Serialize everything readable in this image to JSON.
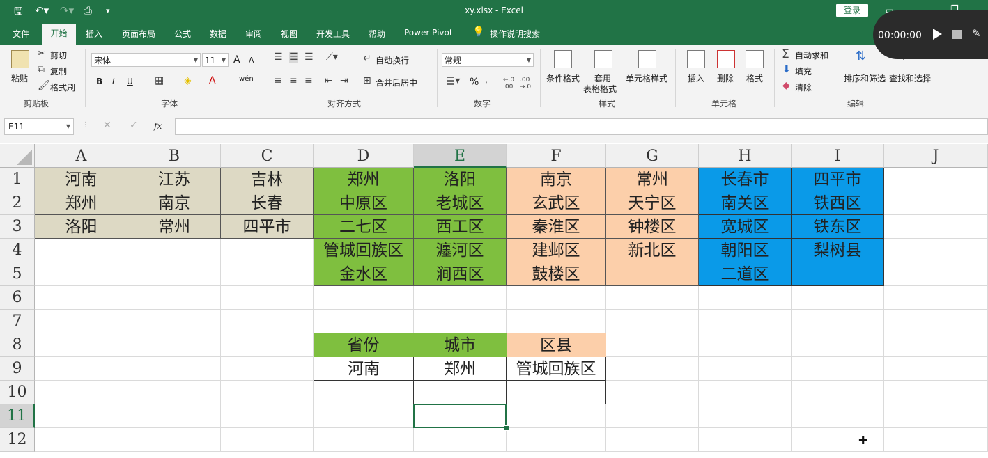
{
  "title": "xy.xlsx  -  Excel",
  "login_label": "登录",
  "tabs": [
    "文件",
    "开始",
    "插入",
    "页面布局",
    "公式",
    "数据",
    "审阅",
    "视图",
    "开发工具",
    "帮助",
    "Power Pivot"
  ],
  "active_tab": "开始",
  "tell_me": "操作说明搜索",
  "clipboard": {
    "paste": "粘贴",
    "cut": "剪切",
    "copy": "复制",
    "format_painter": "格式刷",
    "label": "剪贴板"
  },
  "font": {
    "name": "宋体",
    "size": "11",
    "label": "字体",
    "bold": "B",
    "italic": "I",
    "underline": "U",
    "grow": "A",
    "shrink": "A",
    "wen": "wén"
  },
  "alignment": {
    "wrap": "自动换行",
    "merge": "合并后居中",
    "label": "对齐方式"
  },
  "number": {
    "format": "常规",
    "label": "数字",
    "percent": "%"
  },
  "styles": {
    "conditional": "条件格式",
    "table_line1": "套用",
    "table_line2": "表格格式",
    "cell_styles": "单元格样式",
    "label": "样式"
  },
  "cells": {
    "insert": "插入",
    "delete": "删除",
    "format": "格式",
    "label": "单元格"
  },
  "editing": {
    "autosum": "自动求和",
    "fill": "填充",
    "clear": "清除",
    "sort": "排序和筛选",
    "find": "查找和选择",
    "label": "编辑"
  },
  "recorder": {
    "time": "00:00:00"
  },
  "name_box": "E11",
  "fx": "fx",
  "columns": [
    "A",
    "B",
    "C",
    "D",
    "E",
    "F",
    "G",
    "H",
    "I",
    "J"
  ],
  "rows": [
    "1",
    "2",
    "3",
    "4",
    "5",
    "6",
    "7",
    "8",
    "9",
    "10",
    "11",
    "12"
  ],
  "selected": {
    "col": "E",
    "row": "11"
  },
  "cells_data": {
    "A1": "河南",
    "B1": "江苏",
    "C1": "吉林",
    "D1": "郑州",
    "E1": "洛阳",
    "F1": "南京",
    "G1": "常州",
    "H1": "长春市",
    "I1": "四平市",
    "A2": "郑州",
    "B2": "南京",
    "C2": "长春",
    "D2": "中原区",
    "E2": "老城区",
    "F2": "玄武区",
    "G2": "天宁区",
    "H2": "南关区",
    "I2": "铁西区",
    "A3": "洛阳",
    "B3": "常州",
    "C3": "四平市",
    "D3": "二七区",
    "E3": "西工区",
    "F3": "秦淮区",
    "G3": "钟楼区",
    "H3": "宽城区",
    "I3": "铁东区",
    "D4": "管城回族区",
    "E4": "瀍河区",
    "F4": "建邺区",
    "G4": "新北区",
    "H4": "朝阳区",
    "I4": "梨树县",
    "D5": "金水区",
    "E5": "涧西区",
    "F5": "鼓楼区",
    "H5": "二道区",
    "D8": "省份",
    "E8": "城市",
    "F8": "区县",
    "D9": "河南",
    "E9": "郑州",
    "F9": "管城回族区"
  }
}
